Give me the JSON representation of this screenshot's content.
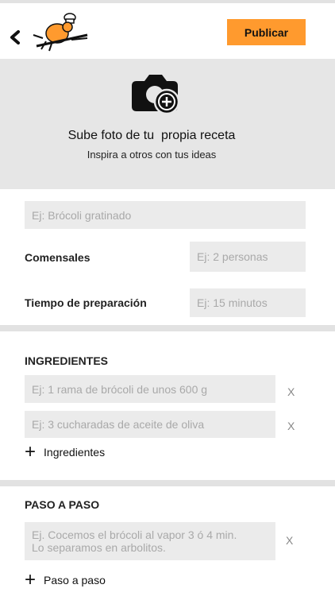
{
  "header": {
    "back_icon": "chevron-left-icon",
    "logo": "chef-mascot-logo",
    "publish_label": "Publicar"
  },
  "photo": {
    "icon": "camera-add-icon",
    "title": "Sube foto de tu  propia receta",
    "subtitle": "Inspira a otros con tus ideas"
  },
  "details": {
    "name_placeholder": "Ej: Brócoli gratinado",
    "diners_label": "Comensales",
    "diners_placeholder": "Ej: 2 personas",
    "time_label": "Tiempo de preparación",
    "time_placeholder": "Ej: 15 minutos"
  },
  "ingredients": {
    "heading": "INGREDIENTES",
    "items": [
      {
        "placeholder": "Ej: 1 rama de brócoli de unos 600 g",
        "remove": "X"
      },
      {
        "placeholder": "Ej: 3 cucharadas de aceite de oliva",
        "remove": "X"
      }
    ],
    "add_label": "Ingredientes"
  },
  "steps": {
    "heading": "PASO A PASO",
    "items": [
      {
        "line1": "Ej. Cocemos el brócoli al vapor 3 ó 4 min.",
        "line2": "Lo separamos en arbolitos.",
        "remove": "X"
      }
    ],
    "add_label": "Paso a paso"
  },
  "colors": {
    "accent": "#ff9a2e",
    "panel": "#e6e6e6",
    "field": "#ebebeb"
  }
}
